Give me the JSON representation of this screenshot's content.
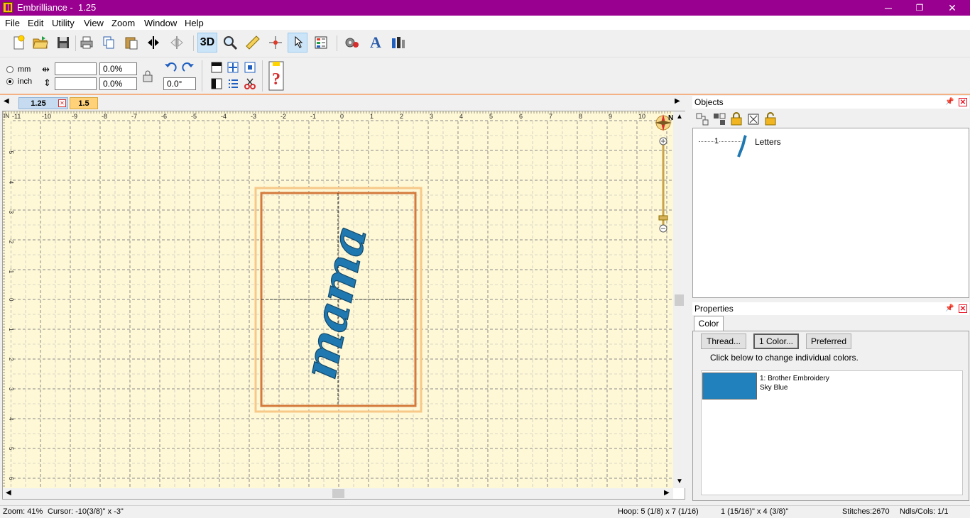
{
  "window": {
    "title": "Embrilliance -  1.25",
    "minimize": "─",
    "maximize": "❐",
    "close": "✕"
  },
  "menu": [
    "File",
    "Edit",
    "Utility",
    "View",
    "Zoom",
    "Window",
    "Help"
  ],
  "toolbar": {
    "three_d_label": "3D"
  },
  "units": {
    "mm": "mm",
    "inch": "inch"
  },
  "transform": {
    "width_value": "",
    "height_value": "",
    "width_pct": "0.0%",
    "height_pct": "0.0%",
    "rotation": "0.0°"
  },
  "tabs": [
    {
      "label": "1.25",
      "active": true
    },
    {
      "label": "1.5",
      "active": false
    }
  ],
  "ruler": {
    "unit": "IN",
    "top_ticks": [
      "-11",
      "-10",
      "-9",
      "-8",
      "-7",
      "-6",
      "-5",
      "-4",
      "-3",
      "-2",
      "-1",
      "0",
      "1",
      "2",
      "3",
      "4",
      "5",
      "6",
      "7",
      "8",
      "9",
      "10"
    ],
    "left_ticks": [
      "-5",
      "-4",
      "-3",
      "-2",
      "-1",
      "0",
      "1",
      "2",
      "3",
      "4",
      "5",
      "6"
    ]
  },
  "compass": {
    "label": "N"
  },
  "design": {
    "text": "mama",
    "color": "#1f78b0"
  },
  "objects": {
    "title": "Objects",
    "items": [
      {
        "index": "1",
        "name": "Letters"
      }
    ]
  },
  "properties": {
    "title": "Properties",
    "tab": "Color",
    "buttons": [
      "Thread...",
      "1 Color...",
      "Preferred"
    ],
    "hint": "Click below to change individual colors.",
    "colors": [
      {
        "line1": "1: Brother Embroidery",
        "line2": "Sky Blue",
        "swatch": "#2181bd"
      }
    ]
  },
  "status": {
    "zoom": "Zoom: 41%",
    "cursor": "Cursor: -10(3/8)\" x -3\"",
    "hoop": "Hoop: 5 (1/8) x 7 (1/16)",
    "size": "1 (15/16)\" x 4 (3/8)\"",
    "stitches": "Stitches:2670",
    "ndls": "Ndls/Cols: 1/1"
  }
}
